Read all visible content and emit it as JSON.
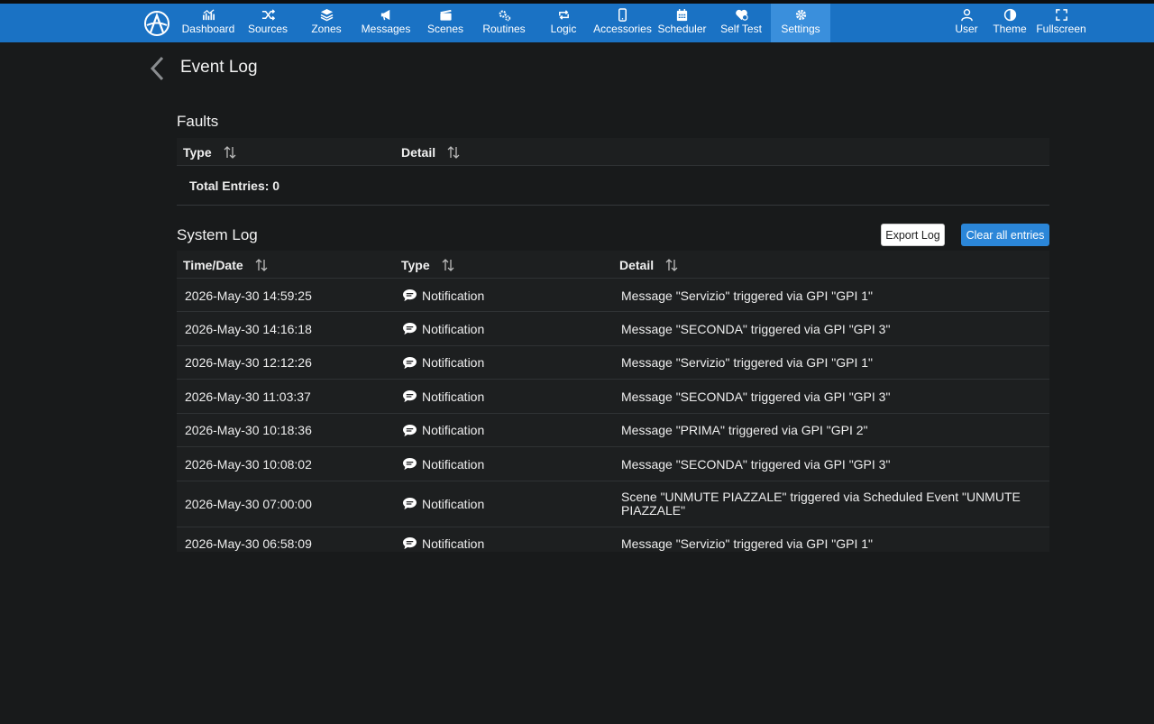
{
  "nav": {
    "items": [
      {
        "label": "Dashboard",
        "icon": "chart-line-icon"
      },
      {
        "label": "Sources",
        "icon": "shuffle-icon"
      },
      {
        "label": "Zones",
        "icon": "layers-icon"
      },
      {
        "label": "Messages",
        "icon": "megaphone-icon"
      },
      {
        "label": "Scenes",
        "icon": "clapperboard-icon"
      },
      {
        "label": "Routines",
        "icon": "gears-icon"
      },
      {
        "label": "Logic",
        "icon": "repeat-icon"
      },
      {
        "label": "Accessories",
        "icon": "phone-icon"
      },
      {
        "label": "Scheduler",
        "icon": "calendar-icon"
      },
      {
        "label": "Self Test",
        "icon": "heart-pulse-icon"
      },
      {
        "label": "Settings",
        "icon": "gear-icon"
      }
    ],
    "active": "Settings",
    "right": [
      {
        "label": "User",
        "icon": "user-icon"
      },
      {
        "label": "Theme",
        "icon": "contrast-icon"
      },
      {
        "label": "Fullscreen",
        "icon": "expand-icon"
      }
    ]
  },
  "page": {
    "title": "Event Log"
  },
  "faults": {
    "title": "Faults",
    "columns": [
      "Type",
      "Detail"
    ],
    "total_label": "Total Entries: 0"
  },
  "system_log": {
    "title": "System Log",
    "export_label": "Export Log",
    "clear_label": "Clear all entries",
    "columns": [
      "Time/Date",
      "Type",
      "Detail"
    ],
    "rows": [
      {
        "time": "2026-May-30 14:59:25",
        "type": "Notification",
        "detail": "Message \"Servizio\" triggered via GPI \"GPI 1\""
      },
      {
        "time": "2026-May-30 14:16:18",
        "type": "Notification",
        "detail": "Message \"SECONDA\" triggered via GPI \"GPI 3\""
      },
      {
        "time": "2026-May-30 12:12:26",
        "type": "Notification",
        "detail": "Message \"Servizio\" triggered via GPI \"GPI 1\""
      },
      {
        "time": "2026-May-30 11:03:37",
        "type": "Notification",
        "detail": "Message \"SECONDA\" triggered via GPI \"GPI 3\""
      },
      {
        "time": "2026-May-30 10:18:36",
        "type": "Notification",
        "detail": "Message \"PRIMA\" triggered via GPI \"GPI 2\""
      },
      {
        "time": "2026-May-30 10:08:02",
        "type": "Notification",
        "detail": "Message \"SECONDA\" triggered via GPI \"GPI 3\""
      },
      {
        "time": "2026-May-30 07:00:00",
        "type": "Notification",
        "detail": "Scene \"UNMUTE PIAZZALE\" triggered via Scheduled Event \"UNMUTE PIAZZALE\""
      },
      {
        "time": "2026-May-30 06:58:09",
        "type": "Notification",
        "detail": "Message \"Servizio\" triggered via GPI \"GPI 1\""
      }
    ]
  },
  "colors": {
    "nav_bg": "#1a72c4",
    "nav_active": "#3a8fdc",
    "page_bg": "#181a1b",
    "button_primary": "#2b86d8"
  }
}
